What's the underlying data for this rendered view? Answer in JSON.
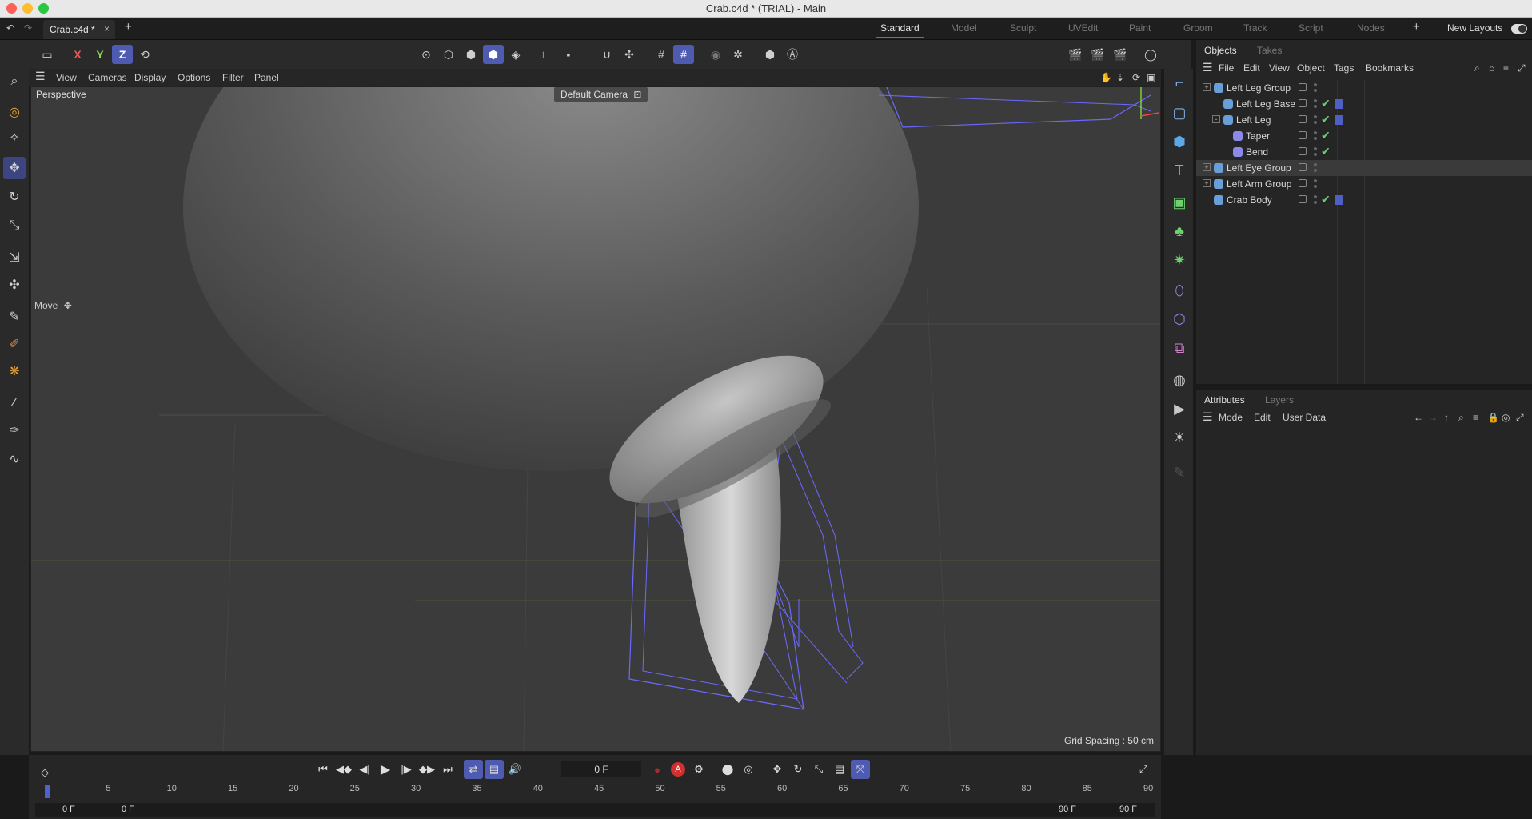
{
  "window": {
    "title": "Crab.c4d * (TRIAL) - Main"
  },
  "tabs": {
    "doc": "Crab.c4d *",
    "layouts": [
      "Standard",
      "Model",
      "Sculpt",
      "UVEdit",
      "Paint",
      "Groom",
      "Track",
      "Script",
      "Nodes"
    ],
    "new_layouts": "New Layouts"
  },
  "toolbar": {
    "x": "X",
    "y": "Y",
    "z": "Z"
  },
  "viewport": {
    "menu": [
      "View",
      "Cameras",
      "Display",
      "Options",
      "Filter",
      "Panel"
    ],
    "title": "Perspective",
    "camera": "Default Camera",
    "tool": "Move",
    "grid_spacing": "Grid Spacing : 50 cm"
  },
  "objects": {
    "tabs": [
      "Objects",
      "Takes"
    ],
    "menu": [
      "File",
      "Edit",
      "View",
      "Object",
      "Tags",
      "Bookmarks"
    ],
    "rows": [
      {
        "label": "Left Leg Group",
        "indent": 0,
        "expand": "+",
        "check": false,
        "tag": false
      },
      {
        "label": "Left Leg Base",
        "indent": 1,
        "expand": "",
        "check": true,
        "tag": true
      },
      {
        "label": "Left Leg",
        "indent": 1,
        "expand": "-",
        "check": true,
        "tag": true
      },
      {
        "label": "Taper",
        "indent": 2,
        "expand": "",
        "check": true,
        "tag": false
      },
      {
        "label": "Bend",
        "indent": 2,
        "expand": "",
        "check": true,
        "tag": false
      },
      {
        "label": "Left Eye Group",
        "indent": 0,
        "expand": "+",
        "check": false,
        "tag": false
      },
      {
        "label": "Left Arm Group",
        "indent": 0,
        "expand": "+",
        "check": false,
        "tag": false
      },
      {
        "label": "Crab Body",
        "indent": 0,
        "expand": "",
        "check": true,
        "tag": true
      }
    ]
  },
  "attributes": {
    "tabs": [
      "Attributes",
      "Layers"
    ],
    "menu": [
      "Mode",
      "Edit",
      "User Data"
    ]
  },
  "timeline": {
    "current_frame": "0 F",
    "ticks": [
      "0",
      "5",
      "10",
      "15",
      "20",
      "25",
      "30",
      "35",
      "40",
      "45",
      "50",
      "55",
      "60",
      "65",
      "70",
      "75",
      "80",
      "85",
      "90"
    ],
    "range_start": "0 F",
    "range_start2": "0 F",
    "range_end": "90 F",
    "range_end2": "90 F"
  }
}
